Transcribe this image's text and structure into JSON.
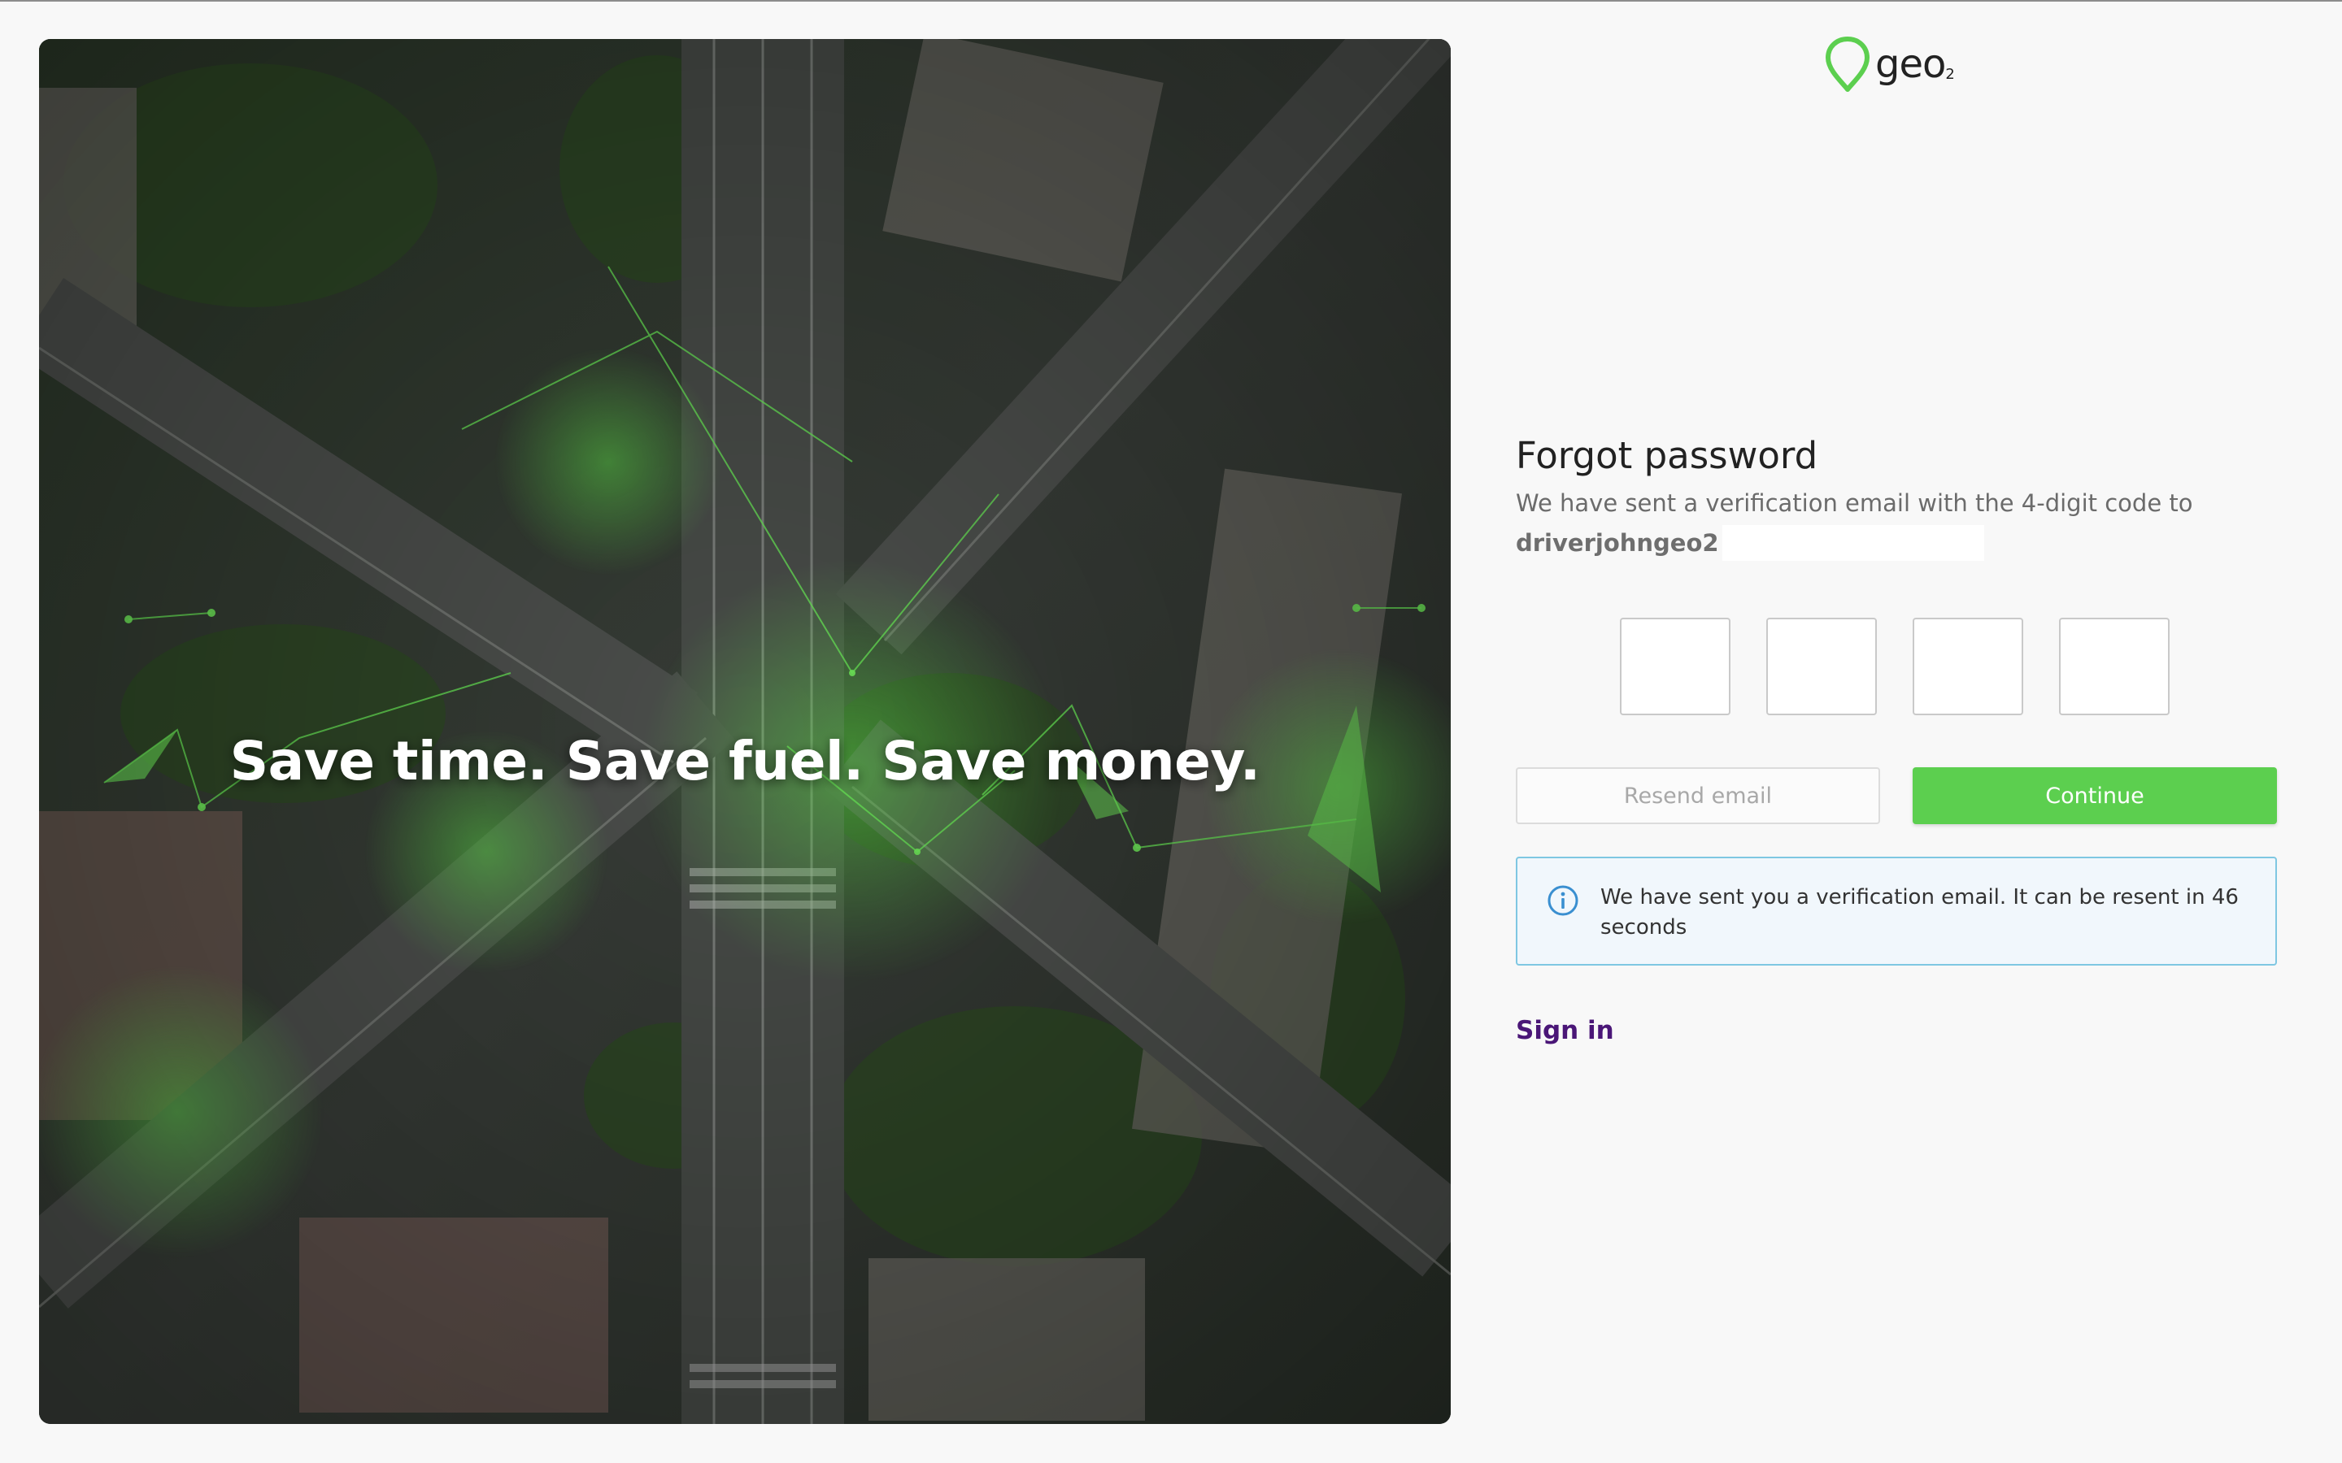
{
  "hero": {
    "tagline": "Save time. Save fuel. Save money."
  },
  "logo": {
    "text": "geo",
    "subscript": "2",
    "brand_color": "#5ccf4f"
  },
  "form": {
    "title": "Forgot password",
    "description": "We have sent a verification email with the 4-digit code to",
    "email_visible": "driverjohngeo2",
    "code_inputs": [
      "",
      "",
      "",
      ""
    ],
    "resend_label": "Resend email",
    "continue_label": "Continue",
    "info_message": "We have sent you a verification email. It can be resent in 46 seconds",
    "signin_label": "Sign in"
  },
  "colors": {
    "accent_green": "#5ccf4f",
    "link_purple": "#4a1677",
    "info_border": "#7fc7e2",
    "info_bg": "#f1f7fc",
    "info_icon": "#3a8fd0"
  }
}
